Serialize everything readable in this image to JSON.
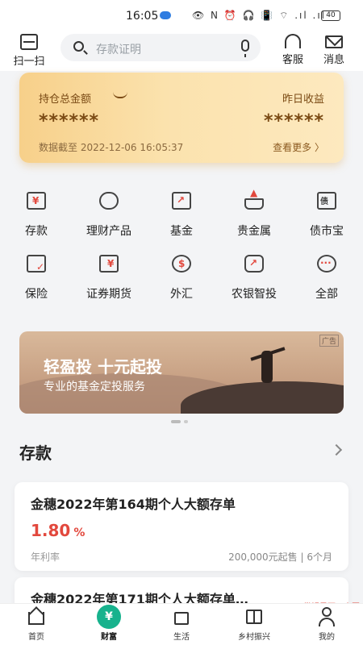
{
  "status_bar": {
    "time": "16:05",
    "indicators": "👁 N ⏰ 🎧 📳 ⌔ .ıl .ıl",
    "battery": "40"
  },
  "header": {
    "scan_label": "扫一扫",
    "search_placeholder": "存款证明",
    "service_label": "客服",
    "message_label": "消息"
  },
  "asset_card": {
    "total_label": "持仓总金额",
    "total_value": "******",
    "yesterday_label": "昨日收益",
    "yesterday_value": "******",
    "data_date": "数据截至 2022-12-06 16:05:37",
    "more_label": "查看更多 〉"
  },
  "grid": [
    {
      "label": "存款",
      "icon": "deposit-house-icon",
      "glyph": "¥"
    },
    {
      "label": "理财产品",
      "icon": "coin-stack-icon",
      "glyph": ""
    },
    {
      "label": "基金",
      "icon": "chart-up-icon",
      "glyph": "↗"
    },
    {
      "label": "贵金属",
      "icon": "gold-bar-icon",
      "glyph": "▲"
    },
    {
      "label": "债市宝",
      "icon": "bond-document-icon",
      "glyph": "债"
    },
    {
      "label": "保险",
      "icon": "insurance-document-icon",
      "glyph": "✓"
    },
    {
      "label": "证券期货",
      "icon": "securities-icon",
      "glyph": "¥"
    },
    {
      "label": "外汇",
      "icon": "forex-exchange-icon",
      "glyph": "$"
    },
    {
      "label": "农银智投",
      "icon": "smart-invest-icon",
      "glyph": "↗"
    },
    {
      "label": "全部",
      "icon": "more-dots-icon",
      "glyph": "···"
    }
  ],
  "banner": {
    "title": "轻盈投  十元起投",
    "subtitle": "专业的基金定投服务",
    "ad_tag": "广告"
  },
  "deposit_section": {
    "title": "存款",
    "products": [
      {
        "name": "金穗2022年第164期个人大额存单",
        "rate": "1.80",
        "rate_unit": "%",
        "rate_label": "年利率",
        "meta": "200,000元起售 | 6个月"
      },
      {
        "name": "金穗2022年第171期个人大额存单…"
      }
    ]
  },
  "bottom_nav": [
    {
      "label": "首页",
      "icon": "home-icon"
    },
    {
      "label": "财富",
      "icon": "wealth-icon",
      "glyph": "¥",
      "active": true
    },
    {
      "label": "生活",
      "icon": "shopping-bag-icon"
    },
    {
      "label": "乡村振兴",
      "icon": "rural-book-icon"
    },
    {
      "label": "我的",
      "icon": "profile-icon"
    }
  ],
  "watermark": "掌银界面示意图",
  "colors": {
    "accent_red": "#e2483d",
    "nav_active": "#17b28d",
    "card_gold": "#f7d08a"
  }
}
